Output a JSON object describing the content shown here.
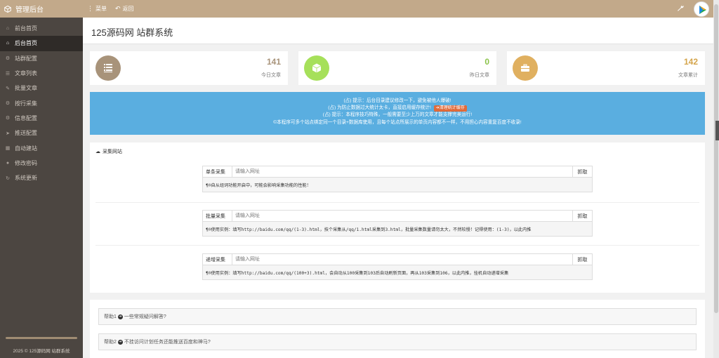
{
  "topbar": {
    "brand": "管理后台",
    "menu_label": "菜单",
    "back_label": "返回",
    "bg_color": "#c2a98a"
  },
  "sidebar": {
    "items": [
      {
        "label": "前台首页",
        "icon": "home-icon"
      },
      {
        "label": "后台首页",
        "icon": "home-icon",
        "active": true
      },
      {
        "label": "站群配置",
        "icon": "gear-icon"
      },
      {
        "label": "文章列表",
        "icon": "list-icon"
      },
      {
        "label": "批量文章",
        "icon": "pencil-icon"
      },
      {
        "label": "按行采集",
        "icon": "gear-icon"
      },
      {
        "label": "信息配置",
        "icon": "gear-icon"
      },
      {
        "label": "推送配置",
        "icon": "send-icon"
      },
      {
        "label": "自动建站",
        "icon": "building-icon"
      },
      {
        "label": "修改密码",
        "icon": "user-icon"
      },
      {
        "label": "系统更新",
        "icon": "refresh-icon"
      }
    ],
    "footer": "2025 © 125源码网 站群系统"
  },
  "page": {
    "title": "125源码网 站群系统"
  },
  "stats": [
    {
      "value": "141",
      "label": "今日文章",
      "color": "#b09a80",
      "num_color": "#a8937a",
      "icon": "list-icon"
    },
    {
      "value": "0",
      "label": "昨日文章",
      "color": "#a6e05a",
      "num_color": "#8bc34a",
      "icon": "cube-icon"
    },
    {
      "value": "142",
      "label": "文章累计",
      "color": "#e0b060",
      "num_color": "#d4a44a",
      "icon": "briefcase-icon"
    }
  ],
  "alert": {
    "line1": "(占) 提示：后台目录建议修改一下，避免被他人爆破!",
    "line2": "(占) 为防止数据过大统计太卡，直接启用缓存统计!",
    "clear_button": "清理统计缓存",
    "line3": "(占) 提示：本程序技巧特殊，一般需要至少上万的文章才能支撑完美运行!",
    "line4": "©本程序可多个站点绑定同一个目录+数据库使用，且每个站点所展示的单页内容都不一样，不用担心内容重复百度不收录!",
    "bg_color": "#5aaee0"
  },
  "collect": {
    "title": "采集网站",
    "groups": [
      {
        "label": "单条采集",
        "placeholder": "请输入网址",
        "button": "抓取",
        "note": "¶®自从组词功能开启中，可能会影响采集功能的性能！"
      },
      {
        "label": "批量采集",
        "placeholder": "请输入网址",
        "button": "抓取",
        "note": "¶®使用实例：填写http://baidu.com/qq/(1-3).html，技个采集从/qq/1.html采集到3.html，批量采集数量请勿太大，不然较慢！记得使用：(1-3)，以此内推"
      },
      {
        "label": "递增采集",
        "placeholder": "请输入网址",
        "button": "抓取",
        "note": "¶®使用实例：填写http://baidu.com/qq/(100+3).html，会自动从100采集到103后自动刷新页面，再从103采集到106，以此内推，挂机自动递增采集"
      }
    ]
  },
  "faq": [
    {
      "prefix": "帮助1",
      "text": "一些常规疑问解答?"
    },
    {
      "prefix": "帮助2",
      "text": "不挂访问计划任务还能推送百度和神马?"
    }
  ]
}
